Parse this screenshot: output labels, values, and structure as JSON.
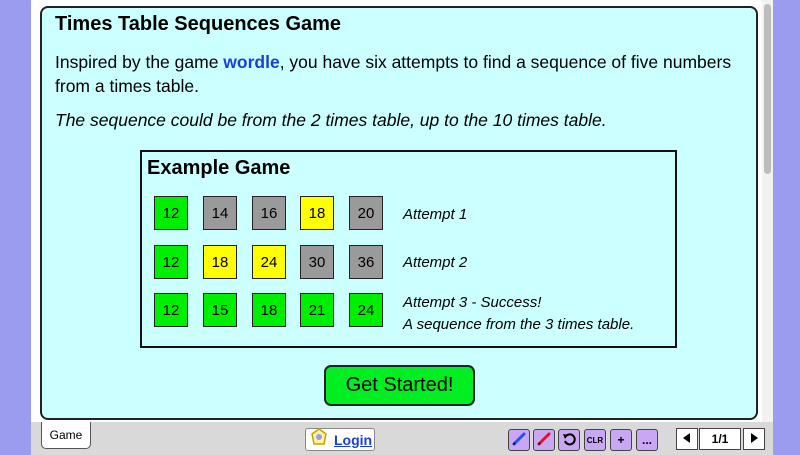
{
  "title": "Times Table Sequences Game",
  "intro": {
    "before": "Inspired by the game ",
    "link": "wordle",
    "after": ", you have six attempts to find a sequence of five numbers from a times table."
  },
  "italic_line": "The sequence could be from the 2 times table, up to the 10 times table.",
  "example": {
    "title": "Example Game",
    "rows": [
      {
        "tiles": [
          {
            "n": "12",
            "c": "green"
          },
          {
            "n": "14",
            "c": "gray"
          },
          {
            "n": "16",
            "c": "gray"
          },
          {
            "n": "18",
            "c": "yellow"
          },
          {
            "n": "20",
            "c": "gray"
          }
        ],
        "label": "Attempt 1",
        "label2": ""
      },
      {
        "tiles": [
          {
            "n": "12",
            "c": "green"
          },
          {
            "n": "18",
            "c": "yellow"
          },
          {
            "n": "24",
            "c": "yellow"
          },
          {
            "n": "30",
            "c": "gray"
          },
          {
            "n": "36",
            "c": "gray"
          }
        ],
        "label": "Attempt 2",
        "label2": ""
      },
      {
        "tiles": [
          {
            "n": "12",
            "c": "green"
          },
          {
            "n": "15",
            "c": "green"
          },
          {
            "n": "18",
            "c": "green"
          },
          {
            "n": "21",
            "c": "green"
          },
          {
            "n": "24",
            "c": "green"
          }
        ],
        "label": "Attempt 3 - Success!",
        "label2": "A sequence from the 3 times table."
      }
    ]
  },
  "start_button": "Get Started!",
  "tab_label": "Game",
  "login_label": "Login",
  "toolbar": {
    "clr": "CLR",
    "plus": "+",
    "more": "..."
  },
  "page_indicator": "1/1",
  "colors": {
    "green": "#00ee00",
    "gray": "#9a9a9a",
    "yellow": "#ffff00",
    "panel": "#ccffff",
    "link": "#1a3fd6"
  }
}
